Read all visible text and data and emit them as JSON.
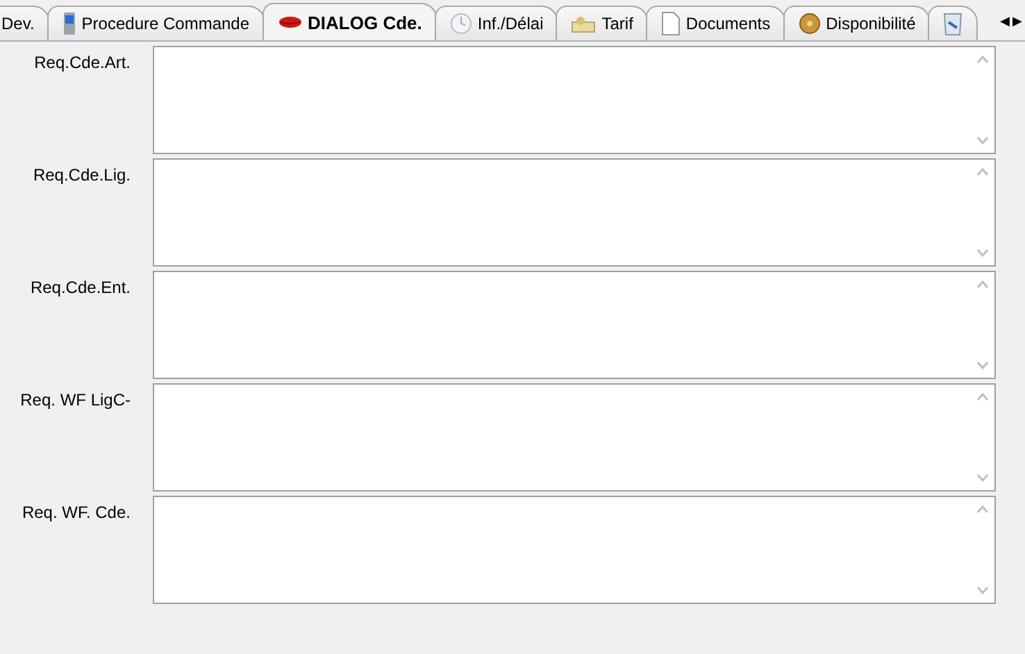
{
  "tabs": [
    {
      "label": "Dev.",
      "selected": false
    },
    {
      "label": "Procedure Commande",
      "selected": false
    },
    {
      "label": "DIALOG Cde.",
      "selected": true
    },
    {
      "label": "Inf./Délai",
      "selected": false
    },
    {
      "label": "Tarif",
      "selected": false
    },
    {
      "label": "Documents",
      "selected": false
    },
    {
      "label": "Disponibilité",
      "selected": false
    },
    {
      "selected": false
    }
  ],
  "tab_scroll": [
    "◀",
    "▶"
  ],
  "fields": [
    {
      "label": "Req.Cde.Art."
    },
    {
      "label": "Req.Cde.Lig."
    },
    {
      "label": "Req.Cde.Ent."
    },
    {
      "label": "Req. WF LigC-"
    },
    {
      "label": "Req. WF. Cde."
    }
  ]
}
